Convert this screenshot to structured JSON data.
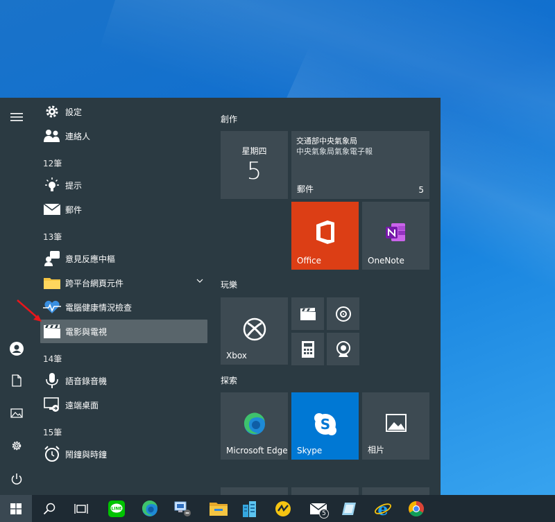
{
  "colors": {
    "menu_bg": "#2b3a42",
    "tile_bg": "#3d4a52",
    "office_tile": "#dc3e15",
    "skype_tile": "#0078d4",
    "taskbar_bg": "#1e2a33",
    "annotation_arrow": "#e8161b"
  },
  "rail": {
    "items": [
      {
        "icon": "hamburger-menu-icon"
      },
      {
        "icon": "user-account-icon"
      },
      {
        "icon": "documents-icon"
      },
      {
        "icon": "pictures-icon"
      },
      {
        "icon": "settings-gear-icon"
      },
      {
        "icon": "power-icon"
      }
    ]
  },
  "app_list": {
    "apps": [
      {
        "label": "設定",
        "icon": "gear-icon"
      },
      {
        "label": "連絡人",
        "icon": "people-icon"
      },
      {
        "label": "提示",
        "icon": "lightbulb-icon"
      },
      {
        "label": "郵件",
        "icon": "mail-icon"
      },
      {
        "label": "意見反應中樞",
        "icon": "feedback-icon"
      },
      {
        "label": "跨平台網頁元件",
        "icon": "folder-icon"
      },
      {
        "label": "電腦健康情況檢查",
        "icon": "heart-pulse-icon"
      },
      {
        "label": "電影與電視",
        "icon": "clapperboard-icon"
      },
      {
        "label": "語音錄音機",
        "icon": "microphone-icon"
      },
      {
        "label": "遠端桌面",
        "icon": "remote-desktop-icon"
      },
      {
        "label": "鬧鐘與時鐘",
        "icon": "alarm-clock-icon"
      }
    ],
    "groups": [
      "12筆",
      "13筆",
      "14筆",
      "15筆"
    ]
  },
  "tiles": {
    "sections": [
      "創作",
      "玩樂",
      "探索"
    ],
    "calendar": {
      "day": "星期四",
      "date": "5"
    },
    "mail": {
      "title": "交通部中央氣象局",
      "subtitle": "中央氣象局氣象電子報",
      "label": "郵件",
      "count": "5"
    },
    "office": {
      "label": "Office"
    },
    "onenote": {
      "label": "OneNote"
    },
    "xbox": {
      "label": "Xbox"
    },
    "edge": {
      "label": "Microsoft Edge"
    },
    "skype": {
      "label": "Skype"
    },
    "photos": {
      "label": "相片"
    }
  },
  "taskbar": {
    "items": [
      {
        "icon": "windows-start-icon"
      },
      {
        "icon": "search-icon"
      },
      {
        "icon": "task-view-icon"
      },
      {
        "icon": "line-app-icon"
      },
      {
        "icon": "edge-icon"
      },
      {
        "icon": "network-computer-icon"
      },
      {
        "icon": "file-explorer-icon"
      },
      {
        "icon": "buildings-app-icon"
      },
      {
        "icon": "yellow-app-icon"
      },
      {
        "icon": "mail-icon"
      },
      {
        "icon": "note-app-icon"
      },
      {
        "icon": "internet-explorer-icon"
      },
      {
        "icon": "chrome-icon"
      }
    ],
    "mail_badge": "5"
  }
}
